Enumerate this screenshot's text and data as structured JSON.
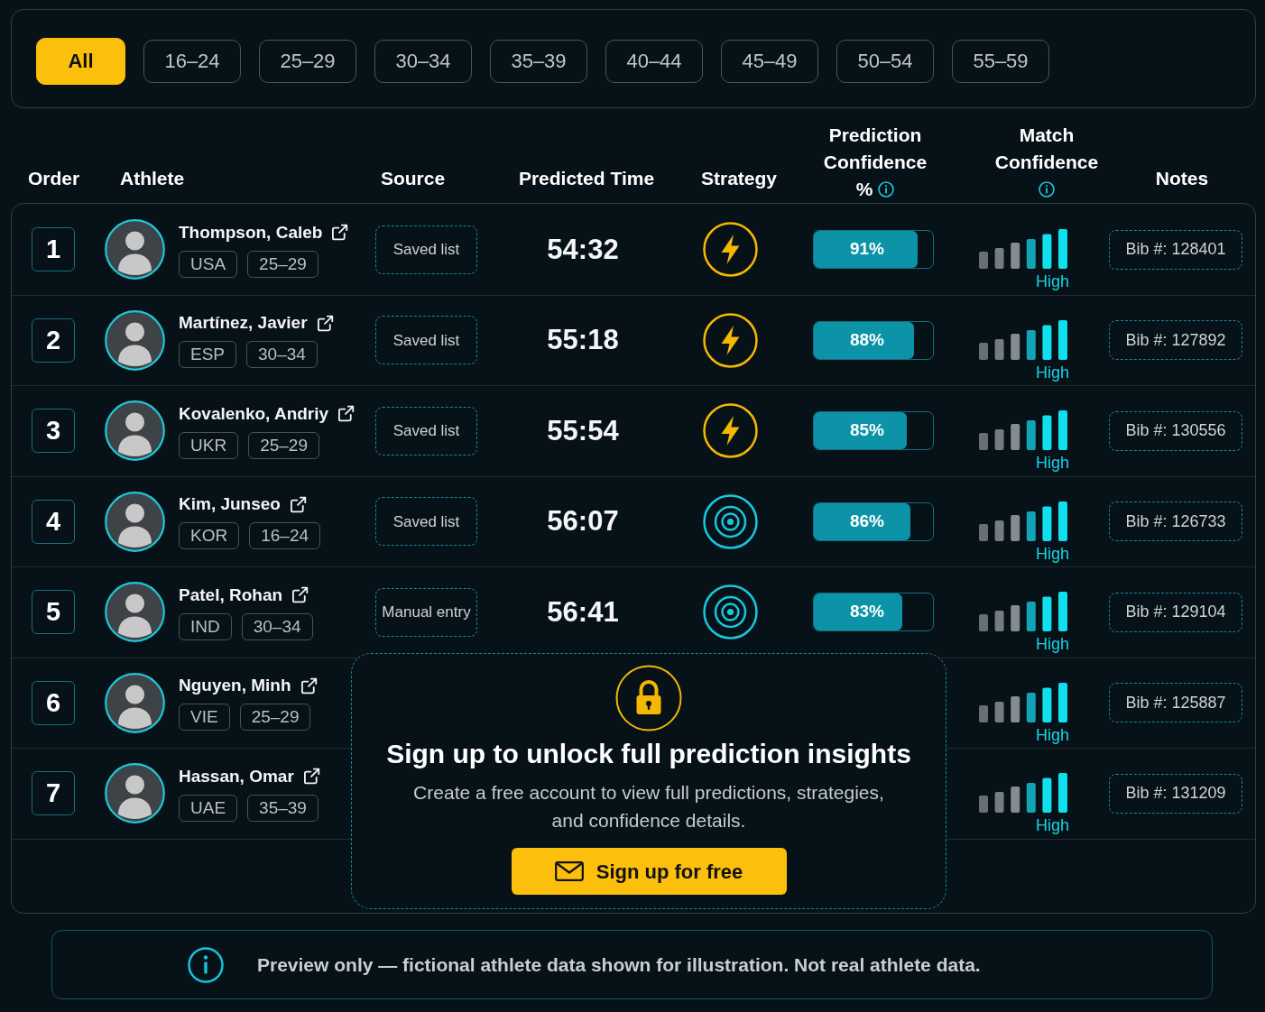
{
  "filters": [
    {
      "label": "All",
      "selected": true
    },
    {
      "label": "16–24",
      "selected": false
    },
    {
      "label": "25–29",
      "selected": false
    },
    {
      "label": "30–34",
      "selected": false
    },
    {
      "label": "35–39",
      "selected": false
    },
    {
      "label": "40–44",
      "selected": false
    },
    {
      "label": "45–49",
      "selected": false
    },
    {
      "label": "50–54",
      "selected": false
    },
    {
      "label": "55–59",
      "selected": false
    }
  ],
  "table": {
    "columns": [
      {
        "label": "Order",
        "info": false
      },
      {
        "label": "Athlete",
        "info": false
      },
      {
        "label": "Source",
        "info": false
      },
      {
        "label": "Predicted Time",
        "info": false
      },
      {
        "label": "Strategy",
        "info": false
      },
      {
        "label": "Prediction Confidence",
        "unit": "%",
        "info": true
      },
      {
        "label": "Match Confidence",
        "info": true
      },
      {
        "label": "Notes",
        "info": false
      }
    ],
    "rows": [
      {
        "order": "1",
        "name": "Thompson, Caleb",
        "country": "USA",
        "age_group": "25–29",
        "source": "Saved list",
        "predicted_time": "54:32",
        "strategy": {
          "kind": "bolt"
        },
        "prediction_confidence": {
          "reading": "91%",
          "level": 0.87
        },
        "match_confidence": "High",
        "notes": "Bib #: 128401"
      },
      {
        "order": "2",
        "name": "Martínez, Javier",
        "country": "ESP",
        "age_group": "30–34",
        "source": "Saved list",
        "predicted_time": "55:18",
        "strategy": {
          "kind": "bolt"
        },
        "prediction_confidence": {
          "reading": "88%",
          "level": 0.84
        },
        "match_confidence": "High",
        "notes": "Bib #: 127892"
      },
      {
        "order": "3",
        "name": "Kovalenko, Andriy",
        "country": "UKR",
        "age_group": "25–29",
        "source": "Saved list",
        "predicted_time": "55:54",
        "strategy": {
          "kind": "bolt"
        },
        "prediction_confidence": {
          "reading": "85%",
          "level": 0.78
        },
        "match_confidence": "High",
        "notes": "Bib #: 130556"
      },
      {
        "order": "4",
        "name": "Kim, Junseo",
        "country": "KOR",
        "age_group": "16–24",
        "source": "Saved list",
        "predicted_time": "56:07",
        "strategy": {
          "kind": "target"
        },
        "prediction_confidence": {
          "reading": "86%",
          "level": 0.81
        },
        "match_confidence": "High",
        "notes": "Bib #: 126733"
      },
      {
        "order": "5",
        "name": "Patel, Rohan",
        "country": "IND",
        "age_group": "30–34",
        "source": "Manual entry",
        "predicted_time": "56:41",
        "strategy": {
          "kind": "target"
        },
        "prediction_confidence": {
          "reading": "83%",
          "level": 0.74
        },
        "match_confidence": "High",
        "notes": "Bib #: 129104"
      },
      {
        "order": "6",
        "name": "Nguyen, Minh",
        "country": "VIE",
        "age_group": "25–29",
        "match_confidence": "High",
        "notes": "Bib #: 125887"
      },
      {
        "order": "7",
        "name": "Hassan, Omar",
        "country": "UAE",
        "age_group": "35–39",
        "match_confidence": "High",
        "notes": "Bib #: 131209"
      }
    ]
  },
  "overlay": {
    "title": "Sign up to unlock full prediction insights",
    "text": "Create a free account to view full predictions, strategies, and confidence details.",
    "button": "Sign up for free"
  },
  "notice": {
    "text": "Preview only — fictional athlete data shown for illustration. Not real athlete data."
  }
}
